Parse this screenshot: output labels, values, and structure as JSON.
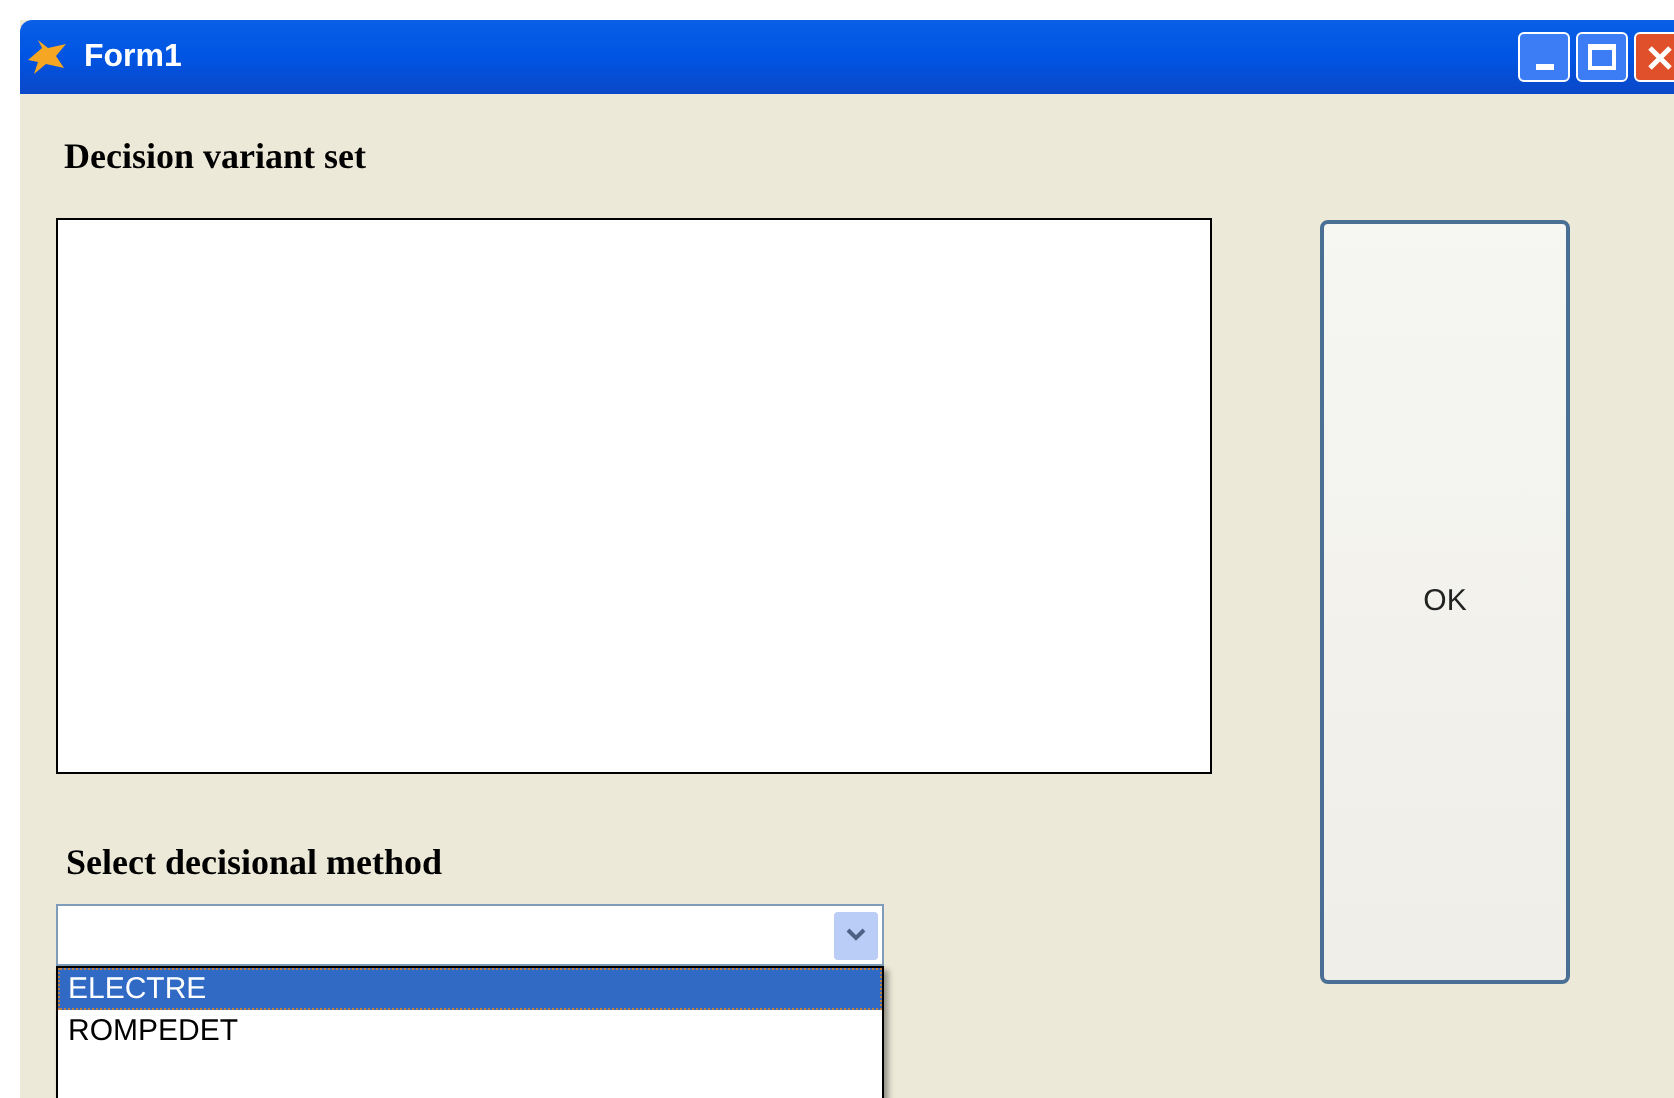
{
  "window": {
    "title": "Form1"
  },
  "variant_set": {
    "label": "Decision variant set"
  },
  "ok_button": {
    "label": "OK"
  },
  "method": {
    "label": "Select decisional method",
    "expanded": true,
    "options": [
      {
        "label": "ELECTRE",
        "selected": true
      },
      {
        "label": "ROMPEDET",
        "selected": false
      }
    ]
  }
}
